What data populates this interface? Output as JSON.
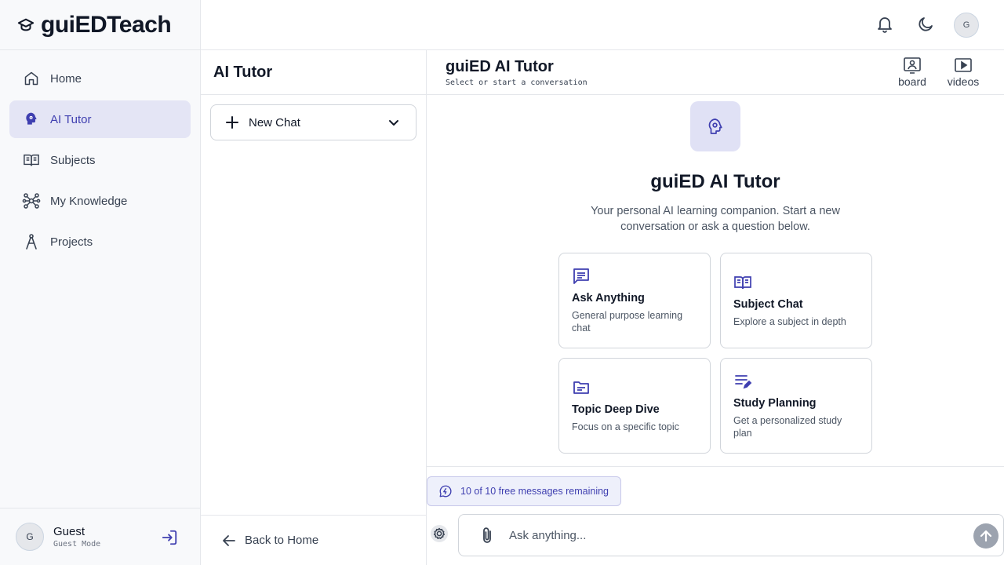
{
  "app": {
    "logo_text": "guiEDTeach"
  },
  "sidebar": {
    "items": [
      {
        "label": "Home",
        "icon": "home-icon"
      },
      {
        "label": "AI Tutor",
        "icon": "brain-gear-icon",
        "active": true
      },
      {
        "label": "Subjects",
        "icon": "book-open-icon"
      },
      {
        "label": "My Knowledge",
        "icon": "network-icon"
      },
      {
        "label": "Projects",
        "icon": "compass-tool-icon"
      }
    ],
    "user": {
      "avatar": "G",
      "name": "Guest",
      "mode": "Guest Mode"
    }
  },
  "topbar": {
    "avatar": "G",
    "icons": [
      "bell-icon",
      "moon-icon"
    ]
  },
  "chat_list": {
    "title": "AI Tutor",
    "new_chat_label": "New Chat",
    "back_label": "Back to Home"
  },
  "main": {
    "title": "guiED AI Tutor",
    "subtitle": "Select or start a conversation",
    "board_label": "board",
    "videos_label": "videos",
    "hero_title": "guiED AI Tutor",
    "hero_desc": "Your personal AI learning companion. Start a new conversation or ask a question below.",
    "cards": [
      {
        "title": "Ask Anything",
        "desc": "General purpose learning chat",
        "icon": "message-lines-icon"
      },
      {
        "title": "Subject Chat",
        "desc": "Explore a subject in depth",
        "icon": "book-open-icon"
      },
      {
        "title": "Topic Deep Dive",
        "desc": "Focus on a specific topic",
        "icon": "folder-icon"
      },
      {
        "title": "Study Planning",
        "desc": "Get a personalized study plan",
        "icon": "list-edit-icon"
      }
    ],
    "quota_text": "10 of 10 free messages remaining",
    "input_placeholder": "Ask anything..."
  },
  "colors": {
    "accent": "#3f3fb0",
    "accent_bg": "#e4e5f5"
  }
}
